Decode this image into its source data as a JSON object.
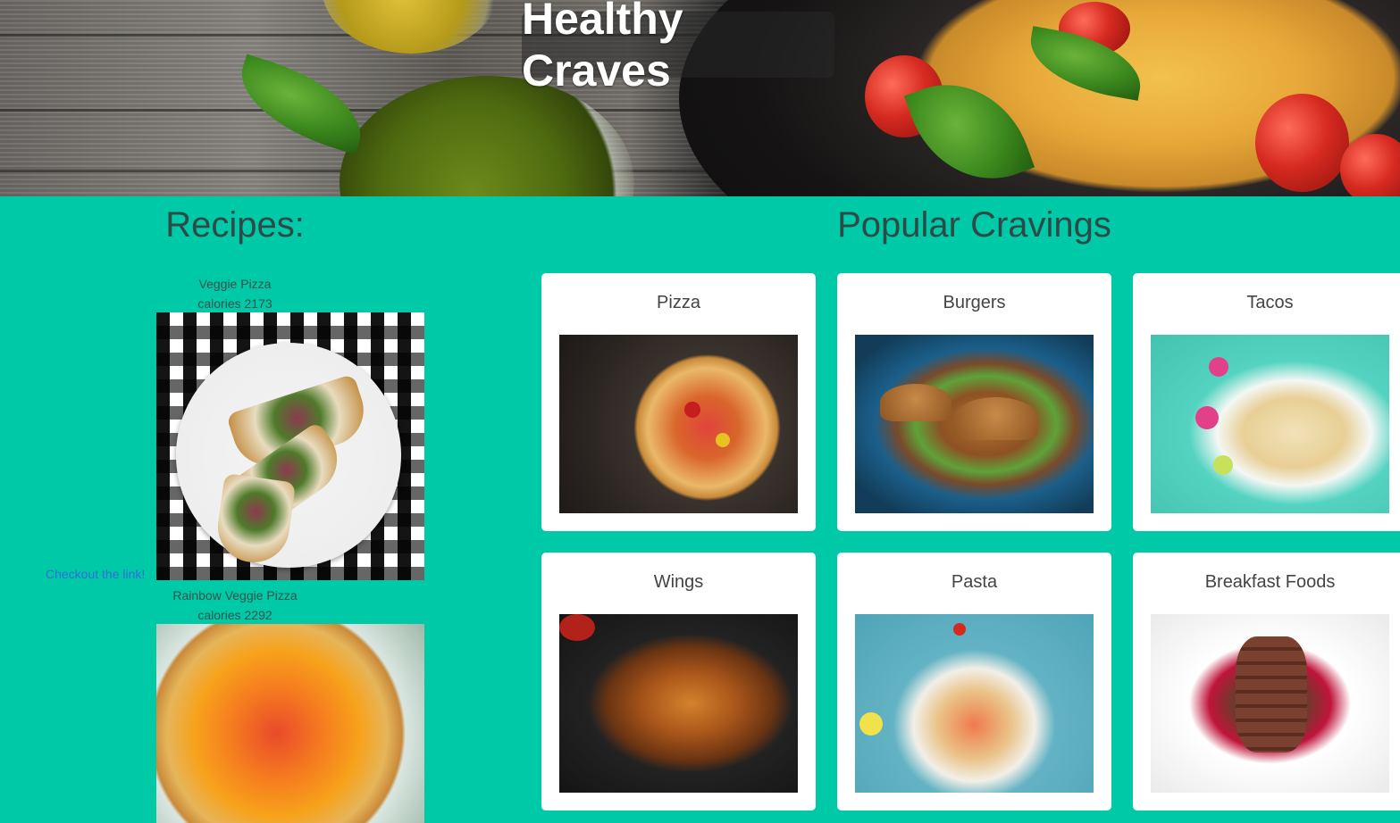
{
  "header": {
    "title": "Healthy Craves"
  },
  "recipes": {
    "heading": "Recipes:",
    "items": [
      {
        "name": "Veggie Pizza",
        "calories": "calories 2173"
      },
      {
        "name": "Rainbow Veggie Pizza",
        "calories": "calories 2292"
      }
    ],
    "link_text": "Checkout the link!"
  },
  "popular": {
    "heading": "Popular Cravings",
    "cards": [
      {
        "label": "Pizza"
      },
      {
        "label": "Burgers"
      },
      {
        "label": "Tacos"
      },
      {
        "label": "Wings"
      },
      {
        "label": "Pasta"
      },
      {
        "label": "Breakfast Foods"
      }
    ]
  },
  "colors": {
    "page_background": "#00c9a7",
    "heading_text": "#2e4a48",
    "card_background": "#ffffff",
    "link": "#2f6fd6"
  }
}
